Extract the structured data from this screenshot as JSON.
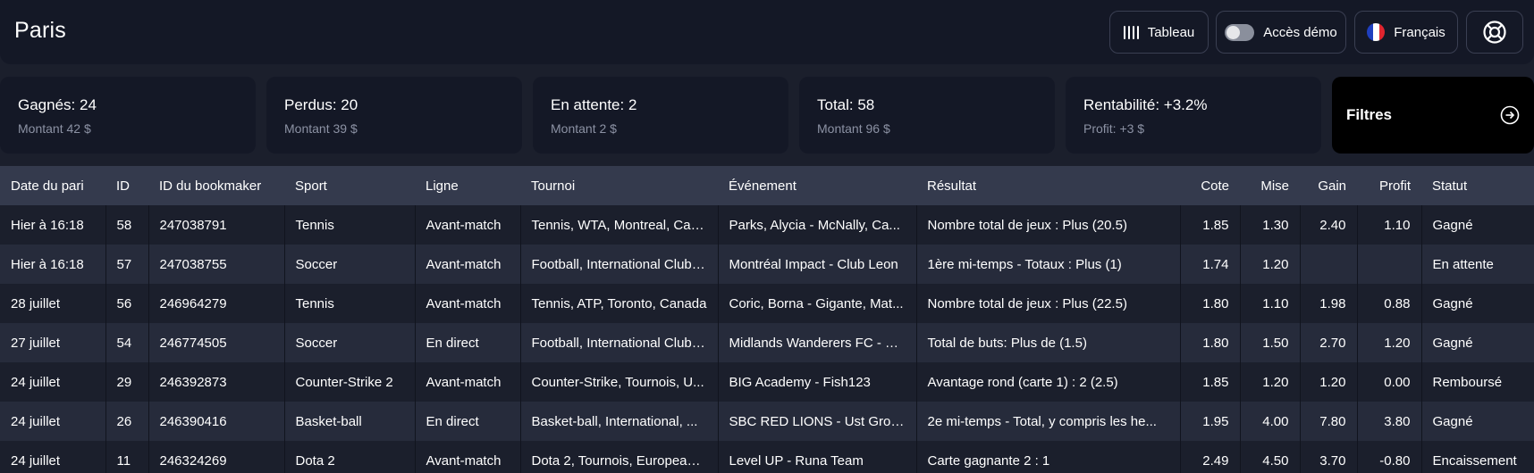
{
  "header": {
    "title": "Paris",
    "tableau_label": "Tableau",
    "demo_label": "Accès démo",
    "demo_enabled": false,
    "language_label": "Français",
    "icons": {
      "tableau": "columns-icon",
      "demo": "toggle-switch",
      "language": "france-flag-icon",
      "help": "lifebuoy-icon"
    }
  },
  "stats": [
    {
      "main": "Gagnés: 24",
      "sub": "Montant 42 $"
    },
    {
      "main": "Perdus: 20",
      "sub": "Montant 39 $"
    },
    {
      "main": "En attente: 2",
      "sub": "Montant 2 $"
    },
    {
      "main": "Total: 58",
      "sub": "Montant 96 $"
    },
    {
      "main": "Rentabilité: +3.2%",
      "sub": "Profit: +3 $"
    }
  ],
  "filters": {
    "label": "Filtres",
    "icon": "arrow-right-circle-icon"
  },
  "table": {
    "headers": [
      "Date du pari",
      "ID",
      "ID du bookmaker",
      "Sport",
      "Ligne",
      "Tournoi",
      "Événement",
      "Résultat",
      "Cote",
      "Mise",
      "Gain",
      "Profit",
      "Statut"
    ],
    "rows": [
      [
        "Hier à 16:18",
        "58",
        "247038791",
        "Tennis",
        "Avant-match",
        "Tennis, WTA, Montreal, Can...",
        "Parks, Alycia - McNally, Ca...",
        "Nombre total de jeux : Plus (20.5)",
        "1.85",
        "1.30",
        "2.40",
        "1.10",
        "Gagné"
      ],
      [
        "Hier à 16:18",
        "57",
        "247038755",
        "Soccer",
        "Avant-match",
        "Football, International Clubs...",
        "Montréal Impact - Club Leon",
        "1ère mi-temps - Totaux : Plus (1)",
        "1.74",
        "1.20",
        "",
        "",
        "En attente"
      ],
      [
        "28 juillet",
        "56",
        "246964279",
        "Tennis",
        "Avant-match",
        "Tennis, ATP, Toronto, Canada",
        "Coric, Borna - Gigante, Mat...",
        "Nombre total de jeux : Plus (22.5)",
        "1.80",
        "1.10",
        "1.98",
        "0.88",
        "Gagné"
      ],
      [
        "27 juillet",
        "54",
        "246774505",
        "Soccer",
        "En direct",
        "Football, International Clubs...",
        "Midlands Wanderers FC - R...",
        "Total de buts: Plus de (1.5)",
        "1.80",
        "1.50",
        "2.70",
        "1.20",
        "Gagné"
      ],
      [
        "24 juillet",
        "29",
        "246392873",
        "Counter-Strike 2",
        "Avant-match",
        "Counter-Strike, Tournois, U...",
        "BIG Academy - Fish123",
        "Avantage rond (carte 1) : 2 (2.5)",
        "1.85",
        "1.20",
        "1.20",
        "0.00",
        "Remboursé"
      ],
      [
        "24 juillet",
        "26",
        "246390416",
        "Basket-ball",
        "En direct",
        "Basket-ball, International, ...",
        "SBC RED LIONS - Ust Grow...",
        "2e mi-temps - Total, y compris les he...",
        "1.95",
        "4.00",
        "7.80",
        "3.80",
        "Gagné"
      ],
      [
        "24 juillet",
        "11",
        "246324269",
        "Dota 2",
        "Avant-match",
        "Dota 2, Tournois, European ...",
        "Level UP - Runa Team",
        "Carte gagnante 2 : 1",
        "2.49",
        "4.50",
        "3.70",
        "-0.80",
        "Encaissement"
      ]
    ]
  },
  "colors": {
    "background": "#1b1f2c",
    "card": "#141826",
    "table_header": "#343a4d",
    "row_alt": "#262b3b",
    "muted_text": "#8c92a4",
    "filters_bg": "#000000"
  }
}
